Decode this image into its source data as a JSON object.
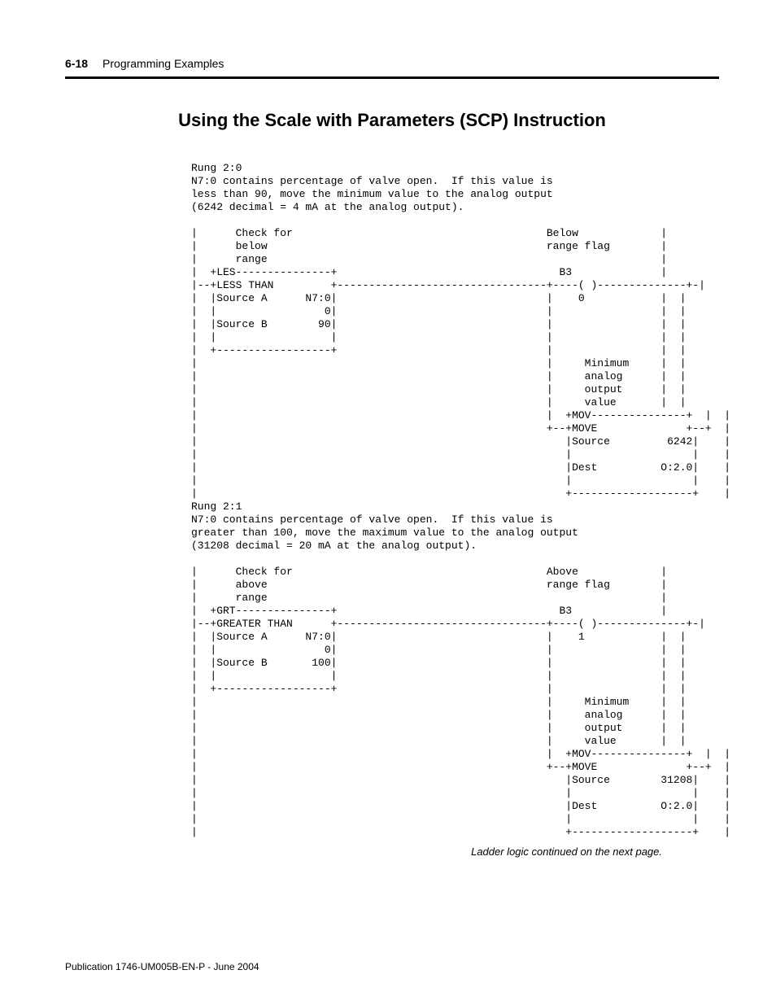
{
  "header": {
    "page_number": "6-18",
    "chapter": "Programming Examples"
  },
  "title": "Using the Scale with Parameters (SCP) Instruction",
  "ladder": "Rung 2:0\nN7:0 contains percentage of valve open.  If this value is\nless than 90, move the minimum value to the analog output\n(6242 decimal = 4 mA at the analog output).\n\n|      Check for                                        Below             |\n|      below                                            range flag        |\n|      range                                                              |\n|  +LES---------------+                                   B3              |\n|--+LESS THAN         +---------------------------------+----( )--------------+-|\n|  |Source A      N7:0|                                 |    0            |  |\n|  |                 0|                                 |                 |  |\n|  |Source B        90|                                 |                 |  |\n|  |                  |                                 |                 |  |\n|  +------------------+                                 |                 |  |\n|                                                       |     Minimum     |  |\n|                                                       |     analog      |  |\n|                                                       |     output      |  |\n|                                                       |     value       |  |\n|                                                       |  +MOV---------------+  |  |\n|                                                       +--+MOVE              +--+  |\n|                                                          |Source         6242|    |\n|                                                          |                   |    |\n|                                                          |Dest          O:2.0|    |\n|                                                          |                   |    |\n|                                                          +-------------------+    |\nRung 2:1\nN7:0 contains percentage of valve open.  If this value is\ngreater than 100, move the maximum value to the analog output\n(31208 decimal = 20 mA at the analog output).\n\n|      Check for                                        Above             |\n|      above                                            range flag        |\n|      range                                                              |\n|  +GRT---------------+                                   B3              |\n|--+GREATER THAN      +---------------------------------+----( )--------------+-|\n|  |Source A      N7:0|                                 |    1            |  |\n|  |                 0|                                 |                 |  |\n|  |Source B       100|                                 |                 |  |\n|  |                  |                                 |                 |  |\n|  +------------------+                                 |                 |  |\n|                                                       |     Minimum     |  |\n|                                                       |     analog      |  |\n|                                                       |     output      |  |\n|                                                       |     value       |  |\n|                                                       |  +MOV---------------+  |  |\n|                                                       +--+MOVE              +--+  |\n|                                                          |Source        31208|    |\n|                                                          |                   |    |\n|                                                          |Dest          O:2.0|    |\n|                                                          |                   |    |\n|                                                          +-------------------+    |",
  "continuation": "Ladder logic continued on the next page.",
  "footer": "Publication 1746-UM005B-EN-P - June 2004"
}
